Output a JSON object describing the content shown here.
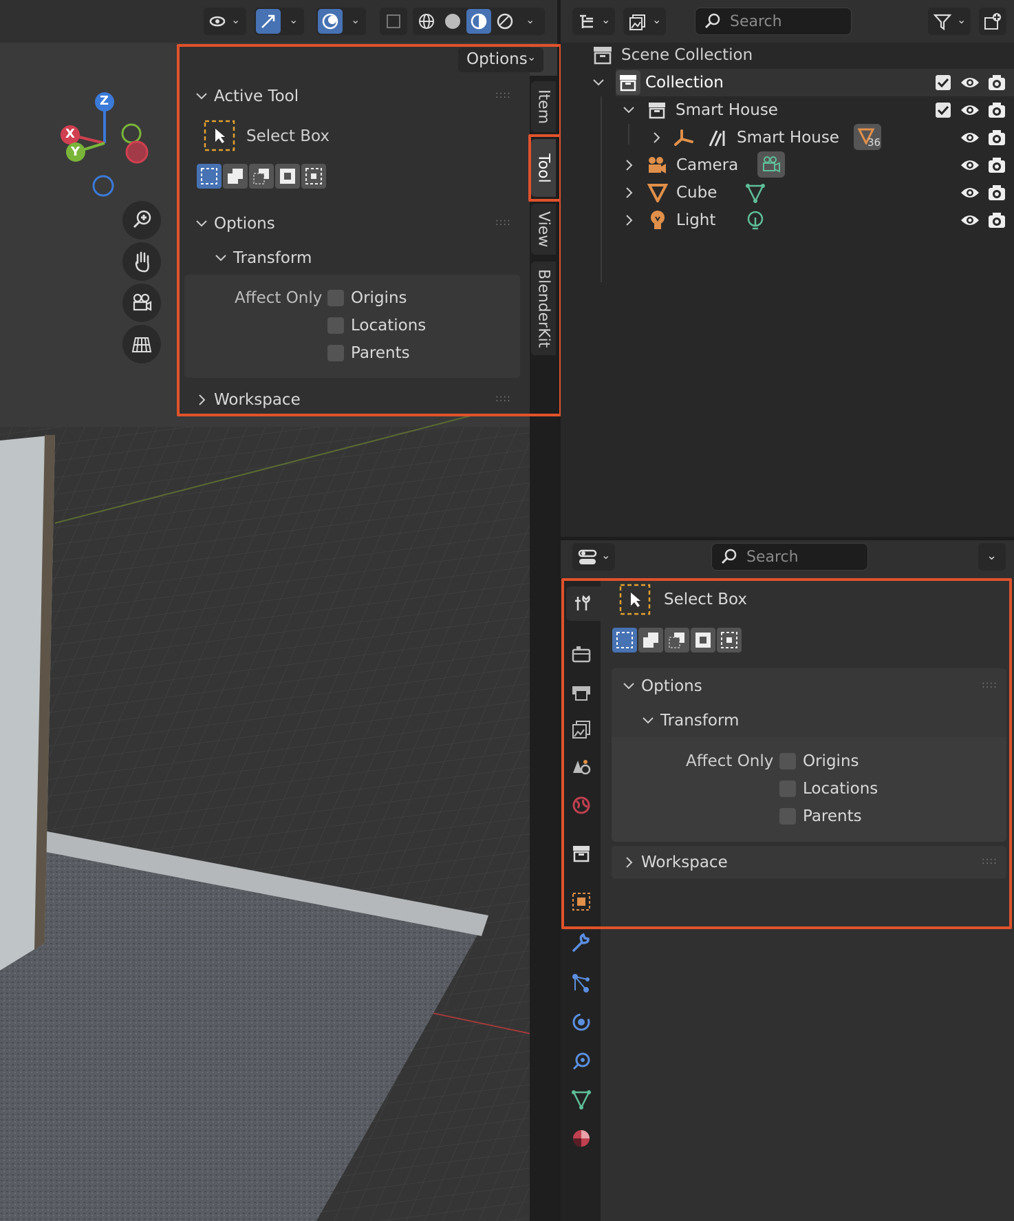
{
  "viewport": {
    "header_buttons": [
      "visibility-dropdown",
      "gizmo-dropdown",
      "overlay-dropdown",
      "xray-toggle",
      "wireframe-shading",
      "solid-shading",
      "material-shading",
      "rendered-shading",
      "shading-dropdown"
    ],
    "gizmo": {
      "z": "Z",
      "x": "X",
      "y": "Y"
    },
    "nav_tools": [
      "zoom-icon",
      "hand-icon",
      "camera-icon",
      "grid-icon"
    ]
  },
  "npanel": {
    "options_label": "Options",
    "active_tool": {
      "header": "Active Tool",
      "tool_name": "Select Box"
    },
    "options": {
      "header": "Options",
      "transform": {
        "header": "Transform",
        "affect_label": "Affect Only",
        "checkboxes": [
          {
            "label": "Origins",
            "checked": false
          },
          {
            "label": "Locations",
            "checked": false
          },
          {
            "label": "Parents",
            "checked": false
          }
        ]
      }
    },
    "workspace": {
      "header": "Workspace"
    },
    "tabs": [
      "Item",
      "Tool",
      "View",
      "BlenderKit"
    ],
    "active_tab": "Tool"
  },
  "outliner": {
    "search_placeholder": "Search",
    "scene_collection": "Scene Collection",
    "collection": "Collection",
    "smart_house_collection": "Smart House",
    "smart_house_object": "Smart House",
    "smart_house_badge": "36",
    "camera": "Camera",
    "cube": "Cube",
    "light": "Light"
  },
  "properties": {
    "search_placeholder": "Search",
    "tool_name": "Select Box",
    "options": {
      "header": "Options",
      "transform": {
        "header": "Transform",
        "affect_label": "Affect Only",
        "checkboxes": [
          {
            "label": "Origins",
            "checked": false
          },
          {
            "label": "Locations",
            "checked": false
          },
          {
            "label": "Parents",
            "checked": false
          }
        ]
      }
    },
    "workspace": {
      "header": "Workspace"
    }
  },
  "colors": {
    "accent": "#4772b3",
    "highlight": "#e0522b",
    "object_orange": "#e0904a",
    "data_green": "#5fbf9a"
  }
}
